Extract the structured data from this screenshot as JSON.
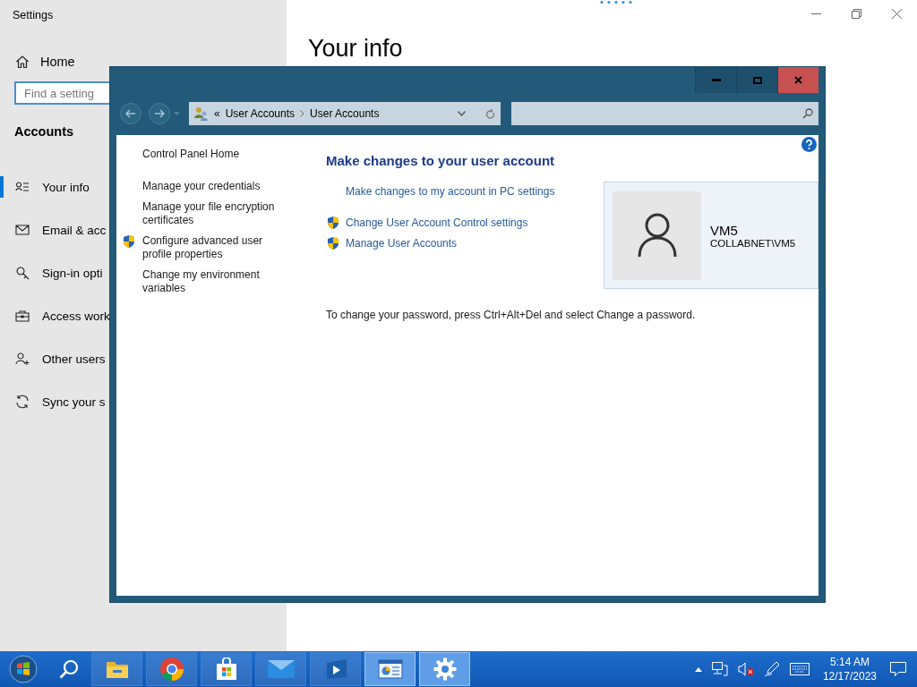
{
  "settings": {
    "title": "Settings",
    "home": "Home",
    "search": {
      "placeholder": "Find a setting"
    },
    "section": "Accounts",
    "heading": "Your info",
    "nav": [
      {
        "label": "Your info",
        "selected": true
      },
      {
        "label": "Email & acc",
        "selected": false
      },
      {
        "label": "Sign-in opti",
        "selected": false
      },
      {
        "label": "Access work",
        "selected": false
      },
      {
        "label": "Other users",
        "selected": false
      },
      {
        "label": "Sync your s",
        "selected": false
      }
    ]
  },
  "control_panel": {
    "breadcrumb": [
      "User Accounts",
      "User Accounts"
    ],
    "overflow": "«",
    "home_link": "Control Panel Home",
    "side_links": [
      {
        "text": "Manage your credentials",
        "shield": false
      },
      {
        "text": "Manage your file encryption certificates",
        "shield": false
      },
      {
        "text": "Configure advanced user profile properties",
        "shield": true
      },
      {
        "text": "Change my environment variables",
        "shield": false
      }
    ],
    "heading": "Make changes to your user account",
    "tasks": [
      {
        "text": "Make changes to my account in PC settings",
        "shield": false
      },
      {
        "text": "Change User Account Control settings",
        "shield": true
      },
      {
        "text": "Manage User Accounts",
        "shield": true
      }
    ],
    "user": {
      "name": "VM5",
      "account": "COLLABNET\\VM5"
    },
    "note": "To change your password, press Ctrl+Alt+Del and select Change a password."
  },
  "taskbar": {
    "apps": [
      {
        "kind": "folder",
        "active": false
      },
      {
        "kind": "browser",
        "active": false
      },
      {
        "kind": "store",
        "active": false
      },
      {
        "kind": "mail",
        "active": false
      },
      {
        "kind": "media",
        "active": false
      },
      {
        "kind": "panel",
        "active": true
      },
      {
        "kind": "gear",
        "active": true
      }
    ],
    "time": "5:14 AM",
    "date": "12/17/2023"
  }
}
